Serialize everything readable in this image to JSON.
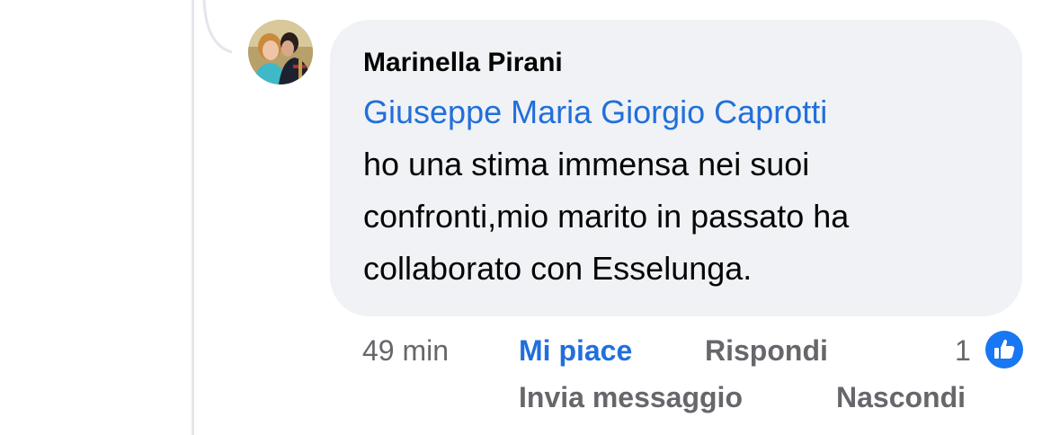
{
  "comment": {
    "author": "Marinella Pirani",
    "mention": "Giuseppe Maria Giorgio Caprotti",
    "text": "ho una stima immensa nei suoi confronti,mio marito in passato ha collaborato con Esselunga."
  },
  "actions": {
    "time": "49 min",
    "like_label": "Mi piace",
    "reply_label": "Rispondi",
    "reaction_count": "1",
    "send_message_label": "Invia messaggio",
    "hide_label": "Nascondi"
  },
  "colors": {
    "accent": "#216fdb",
    "bubble": "#f0f2f5",
    "secondary_text": "#65676b",
    "like_badge": "#1877f2"
  },
  "icons": {
    "reaction": "like-thumb-icon"
  }
}
